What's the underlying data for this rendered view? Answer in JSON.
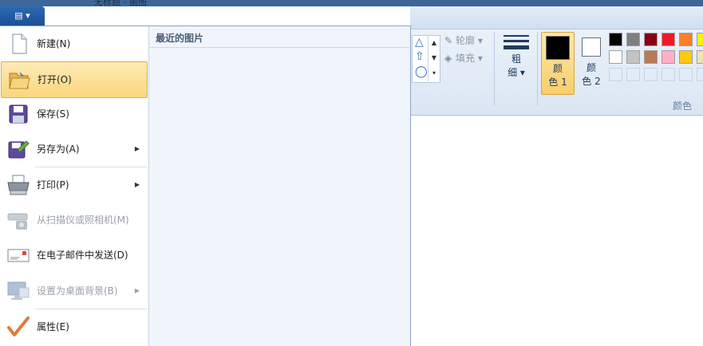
{
  "window": {
    "title": "无标题 - 画图"
  },
  "app_menu": {
    "button_label": "▤ ▾",
    "recent_title": "最近的图片",
    "items": [
      {
        "label": "新建(N)",
        "icon": "new-file-icon",
        "submenu": false,
        "disabled": false,
        "highlighted": false
      },
      {
        "label": "打开(O)",
        "icon": "open-folder-icon",
        "submenu": false,
        "disabled": false,
        "highlighted": true
      },
      {
        "label": "保存(S)",
        "icon": "save-icon",
        "submenu": false,
        "disabled": false,
        "highlighted": false
      },
      {
        "label": "另存为(A)",
        "icon": "save-as-icon",
        "submenu": true,
        "disabled": false,
        "highlighted": false
      },
      {
        "label": "打印(P)",
        "icon": "printer-icon",
        "submenu": true,
        "disabled": false,
        "highlighted": false
      },
      {
        "label": "从扫描仪或照相机(M)",
        "icon": "scanner-icon",
        "submenu": false,
        "disabled": true,
        "highlighted": false
      },
      {
        "label": "在电子邮件中发送(D)",
        "icon": "email-icon",
        "submenu": false,
        "disabled": false,
        "highlighted": false
      },
      {
        "label": "设置为桌面背景(B)",
        "icon": "desktop-background-icon",
        "submenu": true,
        "disabled": true,
        "highlighted": false
      },
      {
        "label": "属性(E)",
        "icon": "checkmark-icon",
        "submenu": false,
        "disabled": false,
        "highlighted": false
      }
    ]
  },
  "ribbon": {
    "outline_label": "轮廓",
    "fill_label": "填充",
    "size_label_1": "粗",
    "size_label_2": "细",
    "color1_label_1": "颜",
    "color1_label_2": "色 1",
    "color2_label_1": "颜",
    "color2_label_2": "色 2",
    "colors_group_label": "颜色",
    "palette_row1": [
      "#000000",
      "#7f7f7f",
      "#880015",
      "#ed1c24",
      "#ff7f27",
      "#fff200"
    ],
    "palette_row2": [
      "#ffffff",
      "#c3c3c3",
      "#b97a57",
      "#ffaec9",
      "#ffc90e",
      "#efe4b0"
    ],
    "color1_value": "#000000",
    "color2_value": "#ffffff"
  }
}
